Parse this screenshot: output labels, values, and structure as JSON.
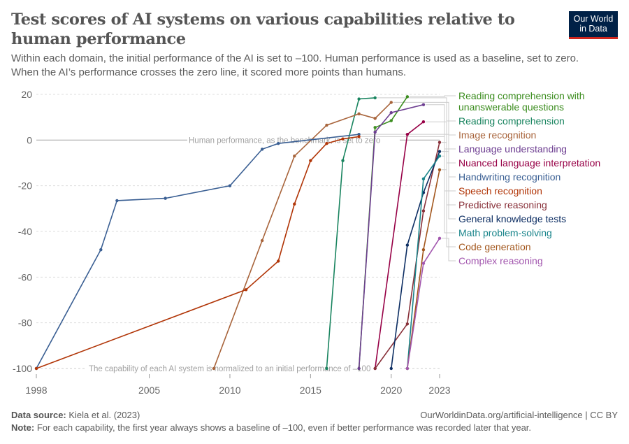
{
  "header": {
    "title": "Test scores of AI systems on various capabilities relative to human performance",
    "subtitle_line1": "Within each domain, the initial performance of the AI is set to –100. Human performance is used as a baseline, set to zero.",
    "subtitle_line2": "When the AI’s performance crosses the zero line, it scored more points than humans.",
    "logo_line1": "Our World",
    "logo_line2": "in Data",
    "logo_colors": {
      "background": "#002147",
      "accent": "#ce261e"
    }
  },
  "footer": {
    "source_label": "Data source:",
    "source_text": "Kiela et al. (2023)",
    "url_text": "OurWorldinData.org/artificial-intelligence | CC BY",
    "note_label": "Note:",
    "note_text": "For each capability, the first year always shows a baseline of –100, even if better performance was recorded later that year."
  },
  "chart_data": {
    "type": "line",
    "title": "Test scores of AI systems on various capabilities relative to human performance",
    "xlabel": "",
    "ylabel": "",
    "xlim": [
      1998,
      2023
    ],
    "ylim": [
      -100,
      20
    ],
    "x_ticks": [
      1998,
      2005,
      2010,
      2015,
      2020,
      2023
    ],
    "y_ticks": [
      20,
      0,
      -20,
      -40,
      -60,
      -80,
      -100
    ],
    "y_tick_labels": [
      "20",
      "0",
      "-20",
      "-40",
      "-60",
      "-80",
      "-100"
    ],
    "grid": "horizontal dashed",
    "legend": "right (line-end labels)",
    "annotations": [
      {
        "text": "Human performance, as the benchmark, is set to zero",
        "y": 0
      },
      {
        "text": "The capability of each AI system is normalized to an initial performance of –100",
        "y": -100
      }
    ],
    "series": [
      {
        "name": "Reading comprehension with unanswerable questions",
        "label_lines": [
          "Reading comprehension with",
          "unanswerable questions"
        ],
        "color": "#3c8d1f",
        "points": [
          [
            2018,
            -100
          ],
          [
            2019,
            5.5
          ],
          [
            2020,
            8.5
          ],
          [
            2021,
            19
          ]
        ]
      },
      {
        "name": "Reading comprehension",
        "label_lines": [
          "Reading comprehension"
        ],
        "color": "#19845f",
        "points": [
          [
            2016,
            -100
          ],
          [
            2017,
            -9
          ],
          [
            2018,
            18
          ],
          [
            2019,
            18.5
          ]
        ]
      },
      {
        "name": "Image recognition",
        "label_lines": [
          "Image recognition"
        ],
        "color": "#a8643b",
        "points": [
          [
            2009,
            -100
          ],
          [
            2012,
            -44
          ],
          [
            2014,
            -7
          ],
          [
            2016,
            6.5
          ],
          [
            2018,
            11.5
          ],
          [
            2019,
            9.5
          ],
          [
            2020,
            16.5
          ]
        ]
      },
      {
        "name": "Language understanding",
        "label_lines": [
          "Language understanding"
        ],
        "color": "#6d3e91",
        "points": [
          [
            2018,
            -100
          ],
          [
            2019,
            3.5
          ],
          [
            2020,
            12
          ],
          [
            2022,
            15.5
          ]
        ]
      },
      {
        "name": "Nuanced language interpretation",
        "label_lines": [
          "Nuanced language interpretation"
        ],
        "color": "#970046",
        "points": [
          [
            2019,
            -100
          ],
          [
            2021,
            2.5
          ],
          [
            2022,
            8
          ]
        ]
      },
      {
        "name": "Handwriting recognition",
        "label_lines": [
          "Handwriting recognition"
        ],
        "color": "#3a5f93",
        "points": [
          [
            1998,
            -100
          ],
          [
            2002,
            -48
          ],
          [
            2003,
            -26.5
          ],
          [
            2006,
            -25.5
          ],
          [
            2010,
            -20
          ],
          [
            2012,
            -4
          ],
          [
            2013,
            -1.5
          ],
          [
            2018,
            2.5
          ]
        ]
      },
      {
        "name": "Speech recognition",
        "label_lines": [
          "Speech recognition"
        ],
        "color": "#b13507",
        "points": [
          [
            1998,
            -100
          ],
          [
            2011,
            -65.5
          ],
          [
            2013,
            -53
          ],
          [
            2014,
            -28
          ],
          [
            2015,
            -9
          ],
          [
            2016,
            -1.5
          ],
          [
            2017,
            0.5
          ],
          [
            2018,
            1.5
          ]
        ]
      },
      {
        "name": "Predictive reasoning",
        "label_lines": [
          "Predictive reasoning"
        ],
        "color": "#883039",
        "points": [
          [
            2019,
            -100
          ],
          [
            2021,
            -80.5
          ],
          [
            2022,
            -31
          ],
          [
            2023,
            -1
          ]
        ]
      },
      {
        "name": "General knowledge tests",
        "label_lines": [
          "General knowledge tests"
        ],
        "color": "#0d2e63",
        "points": [
          [
            2020,
            -100
          ],
          [
            2021,
            -46
          ],
          [
            2022,
            -23
          ],
          [
            2023,
            -5
          ]
        ]
      },
      {
        "name": "Math problem-solving",
        "label_lines": [
          "Math problem-solving"
        ],
        "color": "#18848a",
        "points": [
          [
            2021,
            -100
          ],
          [
            2022,
            -17
          ],
          [
            2023,
            -7
          ]
        ]
      },
      {
        "name": "Code generation",
        "label_lines": [
          "Code generation"
        ],
        "color": "#a2561c",
        "points": [
          [
            2021,
            -100
          ],
          [
            2022,
            -48
          ],
          [
            2023,
            -13
          ]
        ]
      },
      {
        "name": "Complex reasoning",
        "label_lines": [
          "Complex reasoning"
        ],
        "color": "#a256ae",
        "points": [
          [
            2021,
            -100
          ],
          [
            2022,
            -54
          ],
          [
            2023,
            -43
          ]
        ]
      }
    ]
  }
}
